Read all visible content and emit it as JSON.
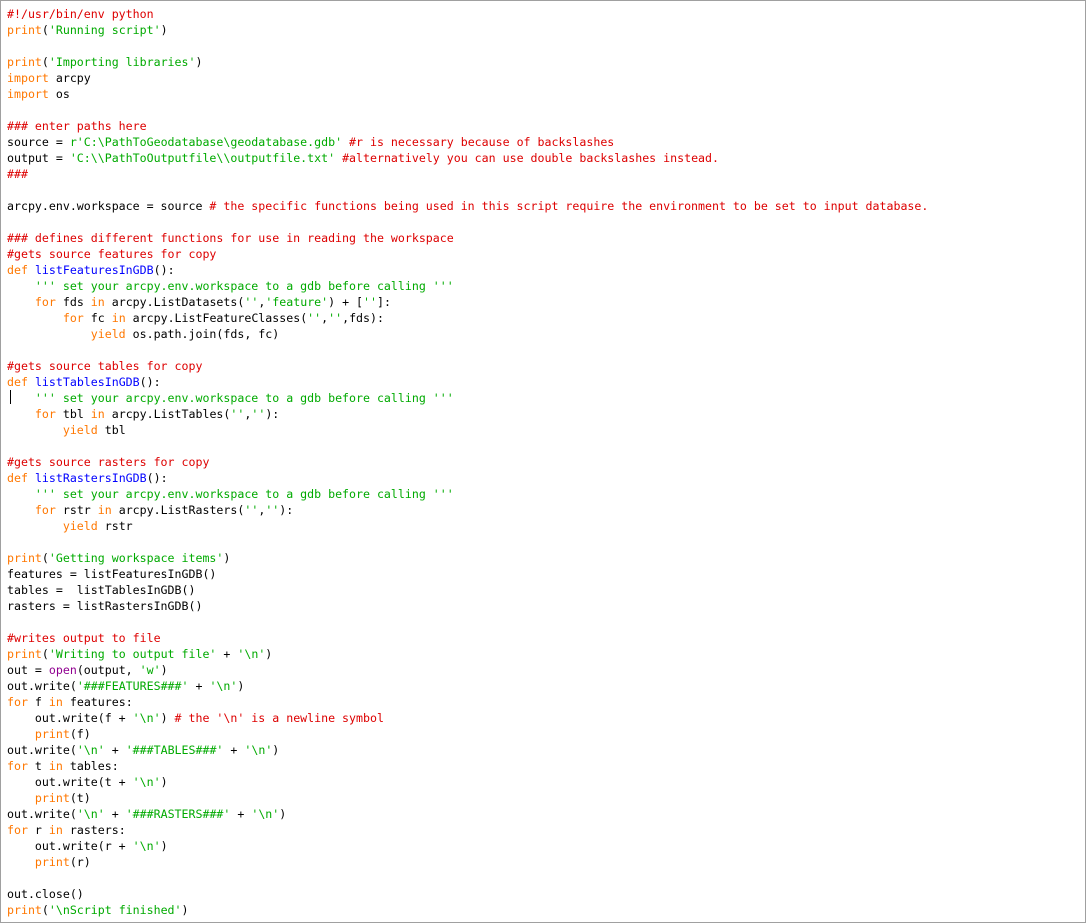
{
  "editor": {
    "colors": {
      "keyword": "#ff7700",
      "string": "#00aa00",
      "comment": "#dd0000",
      "builtin": "#900090",
      "definition": "#0000ff",
      "default": "#000000"
    },
    "lines": [
      [
        [
          "cm",
          "#!/usr/bin/env python"
        ]
      ],
      [
        [
          "kw",
          "print"
        ],
        [
          "",
          "("
        ],
        [
          "str",
          "'Running script'"
        ],
        [
          "",
          ")"
        ]
      ],
      [],
      [
        [
          "kw",
          "print"
        ],
        [
          "",
          "("
        ],
        [
          "str",
          "'Importing libraries'"
        ],
        [
          "",
          ")"
        ]
      ],
      [
        [
          "kw",
          "import"
        ],
        [
          "",
          " arcpy"
        ]
      ],
      [
        [
          "kw",
          "import"
        ],
        [
          "",
          " os"
        ]
      ],
      [],
      [
        [
          "cm",
          "### enter paths here"
        ]
      ],
      [
        [
          "",
          "source = "
        ],
        [
          "str",
          "r'C:\\PathToGeodatabase\\geodatabase.gdb'"
        ],
        [
          "",
          " "
        ],
        [
          "cm",
          "#r is necessary because of backslashes"
        ]
      ],
      [
        [
          "",
          "output = "
        ],
        [
          "str",
          "'C:\\\\PathToOutputfile\\\\outputfile.txt'"
        ],
        [
          "",
          " "
        ],
        [
          "cm",
          "#alternatively you can use double backslashes instead."
        ]
      ],
      [
        [
          "cm",
          "###"
        ]
      ],
      [],
      [
        [
          "",
          "arcpy.env.workspace = source "
        ],
        [
          "cm",
          "# the specific functions being used in this script require the environment to be set to input database."
        ]
      ],
      [],
      [
        [
          "cm",
          "### defines different functions for use in reading the workspace"
        ]
      ],
      [
        [
          "cm",
          "#gets source features for copy"
        ]
      ],
      [
        [
          "kw",
          "def"
        ],
        [
          "",
          " "
        ],
        [
          "def",
          "listFeaturesInGDB"
        ],
        [
          "",
          "():"
        ]
      ],
      [
        [
          "",
          "    "
        ],
        [
          "str",
          "''' set your arcpy.env.workspace to a gdb before calling '''"
        ]
      ],
      [
        [
          "",
          "    "
        ],
        [
          "kw",
          "for"
        ],
        [
          "",
          " fds "
        ],
        [
          "kw",
          "in"
        ],
        [
          "",
          " arcpy.ListDatasets("
        ],
        [
          "str",
          "''"
        ],
        [
          "",
          ","
        ],
        [
          "str",
          "'feature'"
        ],
        [
          "",
          ") + ["
        ],
        [
          "str",
          "''"
        ],
        [
          "",
          "]:"
        ]
      ],
      [
        [
          "",
          "        "
        ],
        [
          "kw",
          "for"
        ],
        [
          "",
          " fc "
        ],
        [
          "kw",
          "in"
        ],
        [
          "",
          " arcpy.ListFeatureClasses("
        ],
        [
          "str",
          "''"
        ],
        [
          "",
          ","
        ],
        [
          "str",
          "''"
        ],
        [
          "",
          ",fds):"
        ]
      ],
      [
        [
          "",
          "            "
        ],
        [
          "kw",
          "yield"
        ],
        [
          "",
          " os.path.join(fds, fc)"
        ]
      ],
      [],
      [
        [
          "cm",
          "#gets source tables for copy"
        ]
      ],
      [
        [
          "kw",
          "def"
        ],
        [
          "",
          " "
        ],
        [
          "def",
          "listTablesInGDB"
        ],
        [
          "",
          "():"
        ]
      ],
      [
        [
          "",
          "    "
        ],
        [
          "str",
          "''' set your arcpy.env.workspace to a gdb before calling '''"
        ]
      ],
      [
        [
          "",
          "    "
        ],
        [
          "kw",
          "for"
        ],
        [
          "",
          " tbl "
        ],
        [
          "kw",
          "in"
        ],
        [
          "",
          " arcpy.ListTables("
        ],
        [
          "str",
          "''"
        ],
        [
          "",
          ","
        ],
        [
          "str",
          "''"
        ],
        [
          "",
          "):"
        ]
      ],
      [
        [
          "",
          "        "
        ],
        [
          "kw",
          "yield"
        ],
        [
          "",
          " tbl"
        ]
      ],
      [],
      [
        [
          "cm",
          "#gets source rasters for copy"
        ]
      ],
      [
        [
          "kw",
          "def"
        ],
        [
          "",
          " "
        ],
        [
          "def",
          "listRastersInGDB"
        ],
        [
          "",
          "():"
        ]
      ],
      [
        [
          "",
          "    "
        ],
        [
          "str",
          "''' set your arcpy.env.workspace to a gdb before calling '''"
        ]
      ],
      [
        [
          "",
          "    "
        ],
        [
          "kw",
          "for"
        ],
        [
          "",
          " rstr "
        ],
        [
          "kw",
          "in"
        ],
        [
          "",
          " arcpy.ListRasters("
        ],
        [
          "str",
          "''"
        ],
        [
          "",
          ","
        ],
        [
          "str",
          "''"
        ],
        [
          "",
          "):"
        ]
      ],
      [
        [
          "",
          "        "
        ],
        [
          "kw",
          "yield"
        ],
        [
          "",
          " rstr"
        ]
      ],
      [],
      [
        [
          "kw",
          "print"
        ],
        [
          "",
          "("
        ],
        [
          "str",
          "'Getting workspace items'"
        ],
        [
          "",
          ")"
        ]
      ],
      [
        [
          "",
          "features = listFeaturesInGDB()"
        ]
      ],
      [
        [
          "",
          "tables =  listTablesInGDB()"
        ]
      ],
      [
        [
          "",
          "rasters = listRastersInGDB()"
        ]
      ],
      [],
      [
        [
          "cm",
          "#writes output to file"
        ]
      ],
      [
        [
          "kw",
          "print"
        ],
        [
          "",
          "("
        ],
        [
          "str",
          "'Writing to output file'"
        ],
        [
          "",
          " + "
        ],
        [
          "str",
          "'\\n'"
        ],
        [
          "",
          ")"
        ]
      ],
      [
        [
          "",
          "out = "
        ],
        [
          "bi",
          "open"
        ],
        [
          "",
          "(output, "
        ],
        [
          "str",
          "'w'"
        ],
        [
          "",
          ")"
        ]
      ],
      [
        [
          "",
          "out.write("
        ],
        [
          "str",
          "'###FEATURES###'"
        ],
        [
          "",
          " + "
        ],
        [
          "str",
          "'\\n'"
        ],
        [
          "",
          ")"
        ]
      ],
      [
        [
          "kw",
          "for"
        ],
        [
          "",
          " f "
        ],
        [
          "kw",
          "in"
        ],
        [
          "",
          " features:"
        ]
      ],
      [
        [
          "",
          "    out.write(f + "
        ],
        [
          "str",
          "'\\n'"
        ],
        [
          "",
          ") "
        ],
        [
          "cm",
          "# the '\\n' is a newline symbol"
        ]
      ],
      [
        [
          "",
          "    "
        ],
        [
          "kw",
          "print"
        ],
        [
          "",
          "(f)"
        ]
      ],
      [
        [
          "",
          "out.write("
        ],
        [
          "str",
          "'\\n'"
        ],
        [
          "",
          " + "
        ],
        [
          "str",
          "'###TABLES###'"
        ],
        [
          "",
          " + "
        ],
        [
          "str",
          "'\\n'"
        ],
        [
          "",
          ")"
        ]
      ],
      [
        [
          "kw",
          "for"
        ],
        [
          "",
          " t "
        ],
        [
          "kw",
          "in"
        ],
        [
          "",
          " tables:"
        ]
      ],
      [
        [
          "",
          "    out.write(t + "
        ],
        [
          "str",
          "'\\n'"
        ],
        [
          "",
          ")"
        ]
      ],
      [
        [
          "",
          "    "
        ],
        [
          "kw",
          "print"
        ],
        [
          "",
          "(t)"
        ]
      ],
      [
        [
          "",
          "out.write("
        ],
        [
          "str",
          "'\\n'"
        ],
        [
          "",
          " + "
        ],
        [
          "str",
          "'###RASTERS###'"
        ],
        [
          "",
          " + "
        ],
        [
          "str",
          "'\\n'"
        ],
        [
          "",
          ")"
        ]
      ],
      [
        [
          "kw",
          "for"
        ],
        [
          "",
          " r "
        ],
        [
          "kw",
          "in"
        ],
        [
          "",
          " rasters:"
        ]
      ],
      [
        [
          "",
          "    out.write(r + "
        ],
        [
          "str",
          "'\\n'"
        ],
        [
          "",
          ")"
        ]
      ],
      [
        [
          "",
          "    "
        ],
        [
          "kw",
          "print"
        ],
        [
          "",
          "(r)"
        ]
      ],
      [],
      [
        [
          "",
          "out.close()"
        ]
      ],
      [
        [
          "kw",
          "print"
        ],
        [
          "",
          "("
        ],
        [
          "str",
          "'\\nScript finished'"
        ],
        [
          "",
          ")"
        ]
      ]
    ]
  }
}
